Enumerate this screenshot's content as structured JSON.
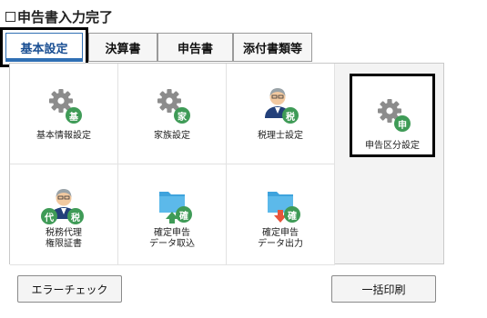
{
  "completion_checkbox": {
    "label": "申告書入力完了",
    "checked": false
  },
  "tabs": [
    {
      "label": "基本設定",
      "active": true
    },
    {
      "label": "決算書",
      "active": false
    },
    {
      "label": "申告書",
      "active": false
    },
    {
      "label": "添付書類等",
      "active": false
    }
  ],
  "tiles": [
    {
      "label": "基本情報設定",
      "icon": "gear-icon",
      "badge": "基"
    },
    {
      "label": "家族設定",
      "icon": "gear-icon",
      "badge": "家"
    },
    {
      "label": "税理士設定",
      "icon": "person-icon",
      "badge": "税"
    },
    {
      "label": "申告区分設定",
      "icon": "gear-icon",
      "badge": "申",
      "selected": true
    },
    {
      "label_line1": "税務代理",
      "label_line2": "権限証書",
      "icon": "person-icon",
      "badges": [
        "代",
        "税"
      ]
    },
    {
      "label_line1": "確定申告",
      "label_line2": "データ取込",
      "icon": "folder-import-icon",
      "badge": "確"
    },
    {
      "label_line1": "確定申告",
      "label_line2": "データ出力",
      "icon": "folder-export-icon",
      "badge": "確"
    }
  ],
  "buttons": {
    "error_check": "エラーチェック",
    "batch_print": "一括印刷"
  },
  "colors": {
    "tab_active_border": "#2f6fb4",
    "badge_green": "#3f9b57",
    "gear_gray": "#8c8c8c"
  }
}
